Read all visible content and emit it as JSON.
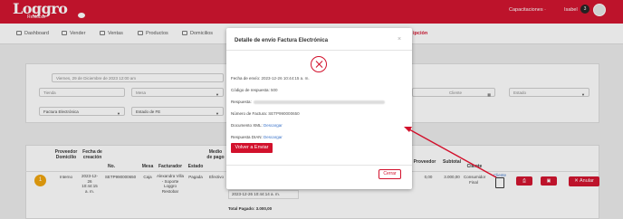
{
  "brand": {
    "logo_text": "Loggro",
    "logo_sub": "Restobar"
  },
  "header": {
    "capacitaciones": "Capacitaciones ·",
    "user": "Isabel",
    "count": "3"
  },
  "nav": {
    "items": [
      "Dashboard",
      "Vender",
      "Ventas",
      "Productos",
      "Domicilios"
    ],
    "active_partial": "ipción"
  },
  "filters": {
    "date_value": "Viernes, 29 de Diciembre de 2023 12:00 am",
    "tienda_placeholder": "Tienda",
    "mesa_placeholder": "Mesa",
    "cliente_placeholder": "Cliente",
    "estado_placeholder": "Estado",
    "doc_type_value": "Factura Electrónica",
    "estado_fe_value": "Estado de FE"
  },
  "table": {
    "headers": [
      "Proveedor Domicilio",
      "Fecha de creación",
      "No.",
      "Mesa",
      "Facturador",
      "Estado",
      "Medio de pago",
      "Proveedor",
      "Subtotal",
      "Cliente"
    ],
    "headers_partial": [
      "Domicilio",
      "Proveedor"
    ],
    "row": {
      "num": "1",
      "proveedor": "Interno",
      "fecha": "2023-12-26 10:44:15 a. m.",
      "no": "SETP990000650",
      "mesa": "Caja",
      "facturador": "Alexandra Villa - Soporte Loggro Restobar",
      "estado": "Pagada",
      "medio": "Efectivo",
      "proveedor_val": "0,00",
      "subtotal": "3.000,00",
      "cliente": "Consumidor Final",
      "cliente_partial": "Cliente",
      "detail_date": "2023-12-26 10:44:14 a. m.",
      "total_label": "Total Pagado: 3.000,00",
      "anular": "Anular"
    }
  },
  "modal": {
    "title": "Detalle de envío Factura Electrónica",
    "close_glyph": "×",
    "fecha_label": "Fecha de envío:",
    "fecha_value": "2023-12-26 10:44:15 a. m.",
    "codigo_label": "Código de respuesta:",
    "codigo_value": "500",
    "respuesta_label": "Respuesta:",
    "numero_label": "Número de Factura:",
    "numero_value": "SETP990000650",
    "xml_label": "Documento XML:",
    "xml_link": "Descargar",
    "dian_label": "Respuesta DIAN:",
    "dian_link": "Descargar",
    "reenviar": "Volver a Enviar",
    "cerrar": "Cerrar"
  },
  "colors": {
    "accent": "#d2112c",
    "link": "#3a73c9",
    "warning": "#f0a30a"
  }
}
